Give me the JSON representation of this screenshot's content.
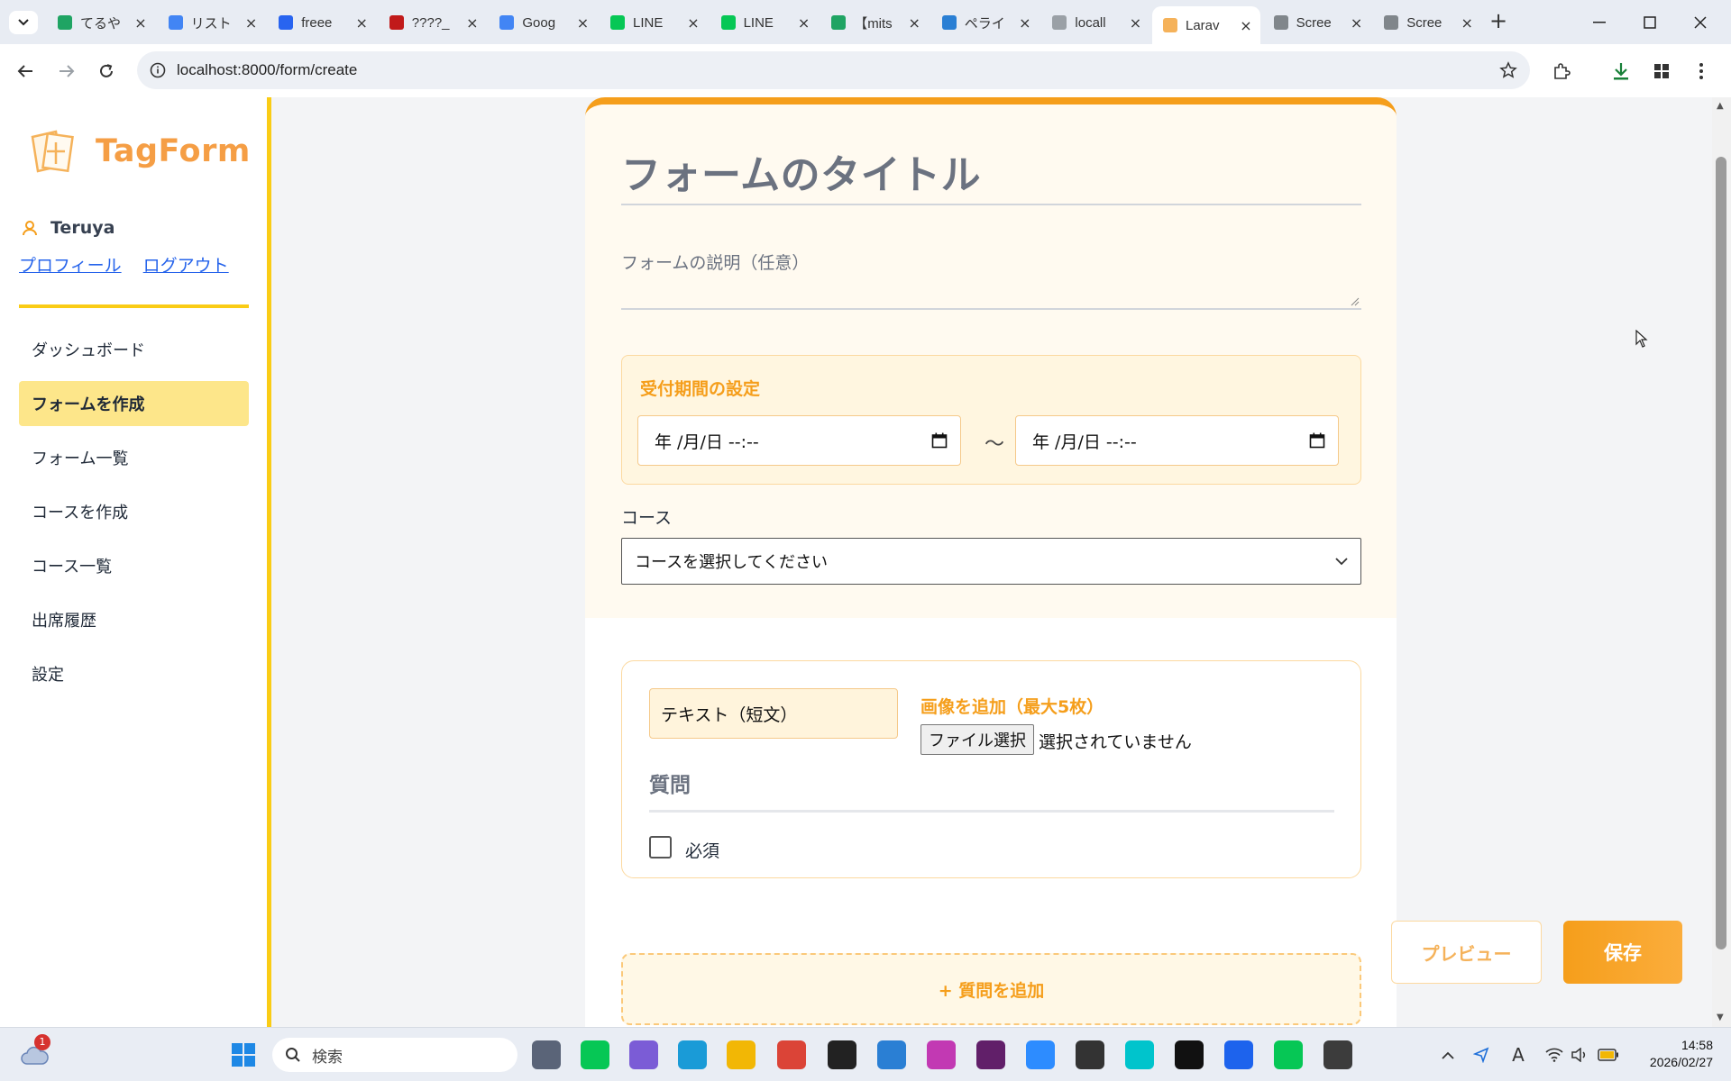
{
  "browser": {
    "tabs": [
      {
        "title": "てるや",
        "icon": "sheets-icon",
        "color": "#1fa463"
      },
      {
        "title": "リスト",
        "icon": "docs-icon",
        "color": "#4285f4"
      },
      {
        "title": "freee",
        "icon": "freee-icon",
        "color": "#2864f0"
      },
      {
        "title": "????_",
        "icon": "pdf-icon",
        "color": "#c11a1a"
      },
      {
        "title": "Goog",
        "icon": "calendar-icon",
        "color": "#4285f4"
      },
      {
        "title": "LINE",
        "icon": "line-icon",
        "color": "#06c755"
      },
      {
        "title": "LINE",
        "icon": "line-icon",
        "color": "#06c755"
      },
      {
        "title": "【mits",
        "icon": "sheets-icon",
        "color": "#1fa463"
      },
      {
        "title": "ペライ",
        "icon": "perai-icon",
        "color": "#2a7fd4"
      },
      {
        "title": "locall",
        "icon": "globe-icon",
        "color": "#9aa0a6"
      },
      {
        "title": "Larav",
        "icon": "tagform-icon",
        "color": "#f5b25a"
      },
      {
        "title": "Scree",
        "icon": "camera-icon",
        "color": "#80868b"
      },
      {
        "title": "Scree",
        "icon": "camera-icon",
        "color": "#80868b"
      }
    ],
    "url": "localhost:8000/form/create"
  },
  "app": {
    "logo_text": "TagForm",
    "user_name": "Teruya",
    "profile_link": "プロフィール",
    "logout_link": "ログアウト",
    "nav": [
      {
        "label": "ダッシュボード",
        "active": false
      },
      {
        "label": "フォームを作成",
        "active": true
      },
      {
        "label": "フォーム一覧",
        "active": false
      },
      {
        "label": "コースを作成",
        "active": false
      },
      {
        "label": "コース一覧",
        "active": false
      },
      {
        "label": "出席履歴",
        "active": false
      },
      {
        "label": "設定",
        "active": false
      }
    ]
  },
  "form": {
    "title_placeholder": "フォームのタイトル",
    "description_placeholder": "フォームの説明（任意）",
    "period_label": "受付期間の設定",
    "start_datetime": "年 /月/日 --:--",
    "end_datetime": "年 /月/日 --:--",
    "period_separator": "〜",
    "course_label": "コース",
    "course_select": "コースを選択してください",
    "question": {
      "type": "テキスト（短文）",
      "image_label": "画像を追加（最大5枚）",
      "file_button": "ファイル選択",
      "file_status": "選択されていません",
      "question_placeholder": "質問",
      "required_label": "必須",
      "required_checked": false
    },
    "add_question": "+ 質問を追加",
    "preview_button": "プレビュー",
    "save_button": "保存"
  },
  "taskbar": {
    "search_placeholder": "検索",
    "time": "14:58",
    "date": "2026/02/27",
    "notification_badge": "1"
  },
  "colors": {
    "accent": "#f59e1b",
    "sidebar_border": "#facc15",
    "active_nav": "#fde68a",
    "link": "#2563eb"
  }
}
